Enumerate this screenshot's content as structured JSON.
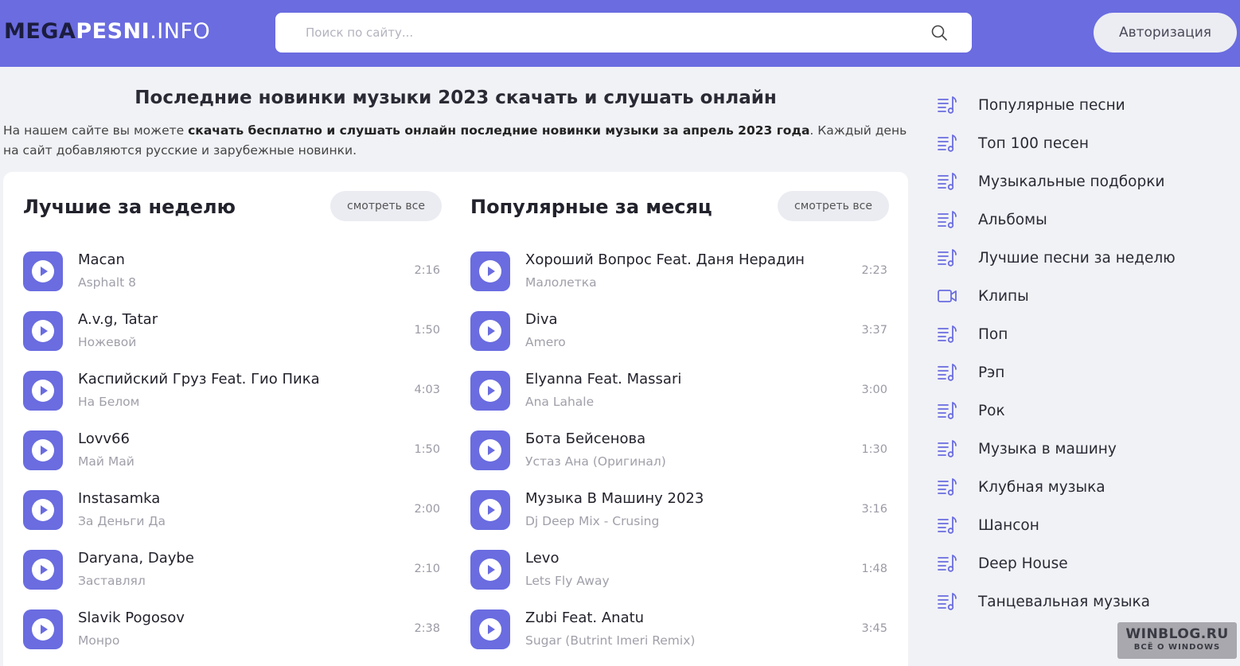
{
  "header": {
    "logo_part1": "MEGA",
    "logo_part2": "PESNI",
    "logo_part3": ".INFO",
    "search_placeholder": "Поиск по сайту...",
    "auth_label": "Авторизация"
  },
  "main": {
    "title": "Последние новинки музыки 2023 скачать и слушать онлайн",
    "intro_pre": "На нашем сайте вы можете ",
    "intro_bold": "скачать бесплатно и слушать онлайн последние новинки музыки за апрель 2023 года",
    "intro_post": ". Каждый день на сайт добавляются русские и зарубежные новинки."
  },
  "weekly": {
    "title": "Лучшие за неделю",
    "view_all": "смотреть все",
    "tracks": [
      {
        "artist": "Macan",
        "song": "Asphalt 8",
        "time": "2:16"
      },
      {
        "artist": "A.v.g, Tatar",
        "song": "Ножевой",
        "time": "1:50"
      },
      {
        "artist": "Каспийский Груз Feat. Гио Пика",
        "song": "На Белом",
        "time": "4:03"
      },
      {
        "artist": "Lovv66",
        "song": "Май Май",
        "time": "1:50"
      },
      {
        "artist": "Instasamka",
        "song": "За Деньги Да",
        "time": "2:00"
      },
      {
        "artist": "Daryana, Daybe",
        "song": "Заставлял",
        "time": "2:10"
      },
      {
        "artist": "Slavik Pogosov",
        "song": "Монро",
        "time": "2:38"
      }
    ]
  },
  "monthly": {
    "title": "Популярные за месяц",
    "view_all": "смотреть все",
    "tracks": [
      {
        "artist": "Хороший Вопрос Feat. Даня Нерадин",
        "song": "Малолетка",
        "time": "2:23"
      },
      {
        "artist": "Diva",
        "song": "Amero",
        "time": "3:37"
      },
      {
        "artist": "Elyanna Feat. Massari",
        "song": "Ana Lahale",
        "time": "3:00"
      },
      {
        "artist": "Бота Бейсенова",
        "song": "Устаз Ана (Оригинал)",
        "time": "1:30"
      },
      {
        "artist": "Музыка В Машину 2023",
        "song": "Dj Deep Mix - Crusing",
        "time": "3:16"
      },
      {
        "artist": "Levo",
        "song": "Lets Fly Away",
        "time": "1:48"
      },
      {
        "artist": "Zubi Feat. Anatu",
        "song": "Sugar (Butrint Imeri Remix)",
        "time": "3:45"
      }
    ]
  },
  "sidebar": {
    "items": [
      {
        "label": "Популярные песни",
        "icon": "music-list-icon"
      },
      {
        "label": "Топ 100 песен",
        "icon": "music-list-icon"
      },
      {
        "label": "Музыкальные подборки",
        "icon": "music-list-icon"
      },
      {
        "label": "Альбомы",
        "icon": "music-list-icon"
      },
      {
        "label": "Лучшие песни за неделю",
        "icon": "music-list-icon"
      },
      {
        "label": "Клипы",
        "icon": "video-camera-icon"
      },
      {
        "label": "Поп",
        "icon": "music-list-icon"
      },
      {
        "label": "Рэп",
        "icon": "music-list-icon"
      },
      {
        "label": "Рок",
        "icon": "music-list-icon"
      },
      {
        "label": "Музыка в машину",
        "icon": "music-list-icon"
      },
      {
        "label": "Клубная музыка",
        "icon": "music-list-icon"
      },
      {
        "label": "Шансон",
        "icon": "music-list-icon"
      },
      {
        "label": "Deep House",
        "icon": "music-list-icon"
      },
      {
        "label": "Танцевальная музыка",
        "icon": "music-list-icon"
      }
    ]
  },
  "watermark": {
    "line1": "WINBLOG.RU",
    "line2": "ВСЁ О WINDOWS"
  },
  "colors": {
    "accent": "#6a6ce0",
    "logo_dark": "#1c1d3f",
    "background": "#f1f2f6"
  }
}
